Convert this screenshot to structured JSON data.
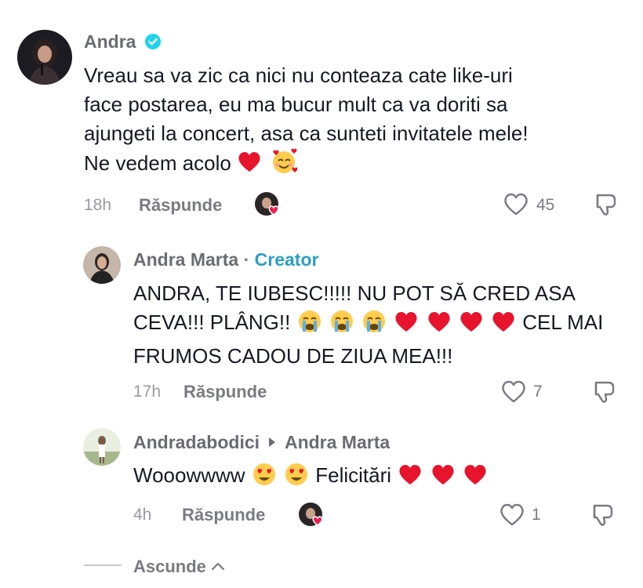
{
  "comments": [
    {
      "author": "Andra",
      "verified": true,
      "text_lines": [
        "Vreau sa va zic ca nici nu conteaza cate like-uri",
        "face postarea, eu ma bucur mult ca va doriti sa",
        "ajungeti la concert, asa ca sunteti invitatele mele!",
        "Ne vedem acolo"
      ],
      "time": "18h",
      "reply_label": "Răspunde",
      "likes": "45"
    },
    {
      "author": "Andra Marta",
      "separator": "·",
      "badge": "Creator",
      "text_lines": [
        "ANDRA, TE IUBESC!!!!! NU POT SĂ CRED ASA",
        "CEVA!!! PLÂNG!!",
        "CEL MAI",
        "FRUMOS CADOU DE ZIUA MEA!!!"
      ],
      "time": "17h",
      "reply_label": "Răspunde",
      "likes": "7"
    },
    {
      "author": "Andradabodici",
      "reply_to": "Andra Marta",
      "text_parts": [
        "Wooowwww",
        "Felicitări"
      ],
      "time": "4h",
      "reply_label": "Răspunde",
      "likes": "1"
    }
  ],
  "footer": {
    "collapse_label": "Ascunde"
  },
  "colors": {
    "accent_creator": "#2a9fc4",
    "verified": "#20d5ec",
    "heart": "#ee1d52"
  }
}
